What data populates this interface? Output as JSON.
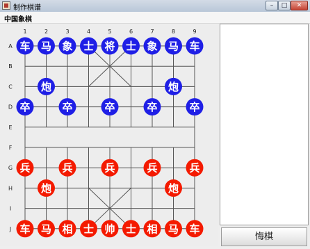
{
  "window": {
    "title": "制作棋谱",
    "controls": {
      "minimize": "–",
      "maximize": "□",
      "close": "✕"
    }
  },
  "menu": {
    "items": [
      "中国象棋"
    ]
  },
  "board": {
    "columns": [
      "1",
      "2",
      "3",
      "4",
      "5",
      "6",
      "7",
      "8",
      "9"
    ],
    "rows": [
      "A",
      "B",
      "C",
      "D",
      "E",
      "F",
      "G",
      "H",
      "I",
      "J"
    ],
    "colors": {
      "blue": "#1f1fe6",
      "red": "#f41a00"
    },
    "pieces": [
      {
        "col": 1,
        "row": "A",
        "char": "车",
        "side": "blue"
      },
      {
        "col": 2,
        "row": "A",
        "char": "马",
        "side": "blue"
      },
      {
        "col": 3,
        "row": "A",
        "char": "象",
        "side": "blue"
      },
      {
        "col": 4,
        "row": "A",
        "char": "士",
        "side": "blue"
      },
      {
        "col": 5,
        "row": "A",
        "char": "将",
        "side": "blue"
      },
      {
        "col": 6,
        "row": "A",
        "char": "士",
        "side": "blue"
      },
      {
        "col": 7,
        "row": "A",
        "char": "象",
        "side": "blue"
      },
      {
        "col": 8,
        "row": "A",
        "char": "马",
        "side": "blue"
      },
      {
        "col": 9,
        "row": "A",
        "char": "车",
        "side": "blue"
      },
      {
        "col": 2,
        "row": "C",
        "char": "炮",
        "side": "blue"
      },
      {
        "col": 8,
        "row": "C",
        "char": "炮",
        "side": "blue"
      },
      {
        "col": 1,
        "row": "D",
        "char": "卒",
        "side": "blue"
      },
      {
        "col": 3,
        "row": "D",
        "char": "卒",
        "side": "blue"
      },
      {
        "col": 5,
        "row": "D",
        "char": "卒",
        "side": "blue"
      },
      {
        "col": 7,
        "row": "D",
        "char": "卒",
        "side": "blue"
      },
      {
        "col": 9,
        "row": "D",
        "char": "卒",
        "side": "blue"
      },
      {
        "col": 1,
        "row": "G",
        "char": "兵",
        "side": "red"
      },
      {
        "col": 3,
        "row": "G",
        "char": "兵",
        "side": "red"
      },
      {
        "col": 5,
        "row": "G",
        "char": "兵",
        "side": "red"
      },
      {
        "col": 7,
        "row": "G",
        "char": "兵",
        "side": "red"
      },
      {
        "col": 9,
        "row": "G",
        "char": "兵",
        "side": "red"
      },
      {
        "col": 2,
        "row": "H",
        "char": "炮",
        "side": "red"
      },
      {
        "col": 8,
        "row": "H",
        "char": "炮",
        "side": "red"
      },
      {
        "col": 1,
        "row": "J",
        "char": "车",
        "side": "red"
      },
      {
        "col": 2,
        "row": "J",
        "char": "马",
        "side": "red"
      },
      {
        "col": 3,
        "row": "J",
        "char": "相",
        "side": "red"
      },
      {
        "col": 4,
        "row": "J",
        "char": "士",
        "side": "red"
      },
      {
        "col": 5,
        "row": "J",
        "char": "帅",
        "side": "red"
      },
      {
        "col": 6,
        "row": "J",
        "char": "士",
        "side": "red"
      },
      {
        "col": 7,
        "row": "J",
        "char": "相",
        "side": "red"
      },
      {
        "col": 8,
        "row": "J",
        "char": "马",
        "side": "red"
      },
      {
        "col": 9,
        "row": "J",
        "char": "车",
        "side": "red"
      }
    ]
  },
  "sidebar": {
    "undo_label": "悔棋"
  }
}
